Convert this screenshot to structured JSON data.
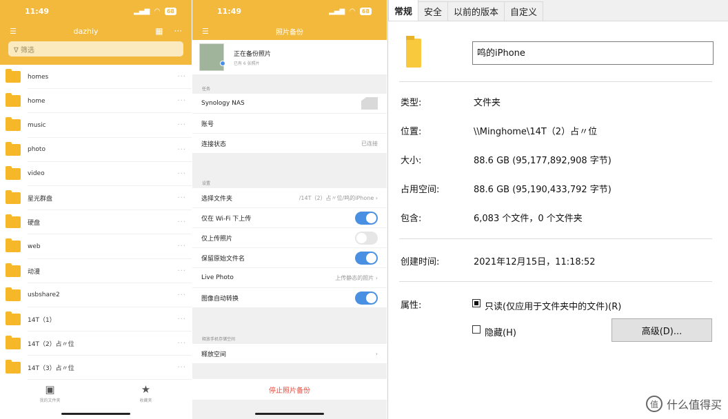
{
  "phone1": {
    "status": {
      "time": "11:49",
      "signal": "▂▄▆",
      "wifi": "◠",
      "battery": "68"
    },
    "nav": {
      "menu_icon": "☰",
      "title": "dazhiy",
      "qr_icon": "▦",
      "more_icon": "···"
    },
    "search": {
      "placeholder": "∇ 筛选"
    },
    "folders": [
      "homes",
      "home",
      "music",
      "photo",
      "video",
      "星光群盘",
      "硬盘",
      "web",
      "动漫",
      "usbshare2",
      "14T（1）",
      "14T（2）占〃位",
      "14T（3）占〃位"
    ],
    "folder_more": "···",
    "tabs": [
      {
        "icon": "▣",
        "label": "我的文件夹"
      },
      {
        "icon": "★",
        "label": "收藏夹"
      }
    ]
  },
  "phone2": {
    "status": {
      "time": "11:49",
      "signal": "▂▄▆",
      "wifi": "◠",
      "battery": "68"
    },
    "nav": {
      "menu_icon": "☰",
      "title": "照片备份"
    },
    "backup": {
      "title": "正在备份照片",
      "subtitle": "已有 6 张照片"
    },
    "sections": [
      {
        "header": "任务",
        "rows": [
          {
            "label": "Synology NAS",
            "value": "",
            "kind": "icon"
          },
          {
            "label": "账号",
            "value": "",
            "kind": "text"
          },
          {
            "label": "连接状态",
            "value": "已连接",
            "kind": "text"
          }
        ]
      },
      {
        "header": "设置",
        "rows": [
          {
            "label": "选择文件夹",
            "value": "/14T（2）占〃位/鸣的iPhone ›",
            "kind": "text"
          },
          {
            "label": "仅在 Wi-Fi 下上传",
            "value": "",
            "kind": "toggle",
            "on": true
          },
          {
            "label": "仅上传照片",
            "value": "",
            "kind": "toggle",
            "on": false
          },
          {
            "label": "保留原始文件名",
            "value": "",
            "kind": "toggle",
            "on": true
          },
          {
            "label": "Live Photo",
            "value": "上传静态的照片 ›",
            "kind": "text"
          },
          {
            "label": "图像自动转换",
            "value": "",
            "kind": "toggle",
            "on": true
          }
        ]
      },
      {
        "header": "释放手机存储空间",
        "rows": [
          {
            "label": "释放空间",
            "value": "›",
            "kind": "text"
          }
        ]
      }
    ],
    "stop_button": "停止照片备份"
  },
  "dialog": {
    "tabs": [
      "常规",
      "安全",
      "以前的版本",
      "自定义"
    ],
    "folder_name": "鸣的iPhone",
    "props": {
      "type_label": "类型:",
      "type_value": "文件夹",
      "location_label": "位置:",
      "location_value": "\\\\Minghome\\14T（2）占〃位",
      "size_label": "大小:",
      "size_value": "88.6 GB (95,177,892,908 字节)",
      "disk_label": "占用空间:",
      "disk_value": "88.6 GB (95,190,433,792 字节)",
      "contains_label": "包含:",
      "contains_value": "6,083 个文件，0 个文件夹",
      "created_label": "创建时间:",
      "created_value": "2021年12月15日，11:18:52",
      "attr_label": "属性:",
      "readonly_label": "只读(仅应用于文件夹中的文件)(R)",
      "readonly_checked": true,
      "hidden_label": "隐藏(H)",
      "hidden_checked": false,
      "advanced_button": "高级(D)..."
    },
    "watermark": {
      "logo": "值",
      "text": "什么值得买"
    }
  }
}
